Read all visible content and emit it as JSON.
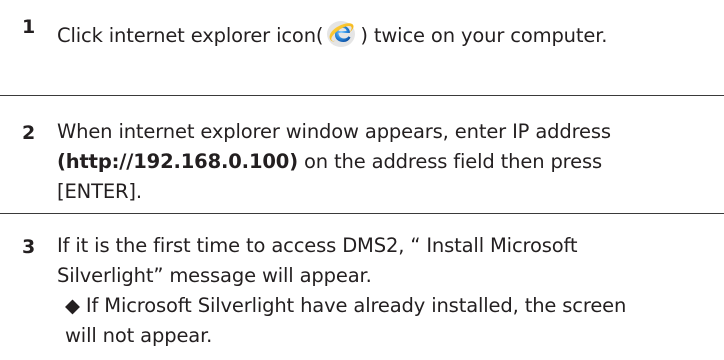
{
  "steps": [
    {
      "number": "1",
      "text_before_icon": "Click internet explorer icon(",
      "icon": "internet-explorer-icon",
      "text_after_icon": ") twice on your computer."
    },
    {
      "number": "2",
      "line1": "When internet explorer window appears, enter IP address",
      "address_bold": "(http://192.168.0.100)",
      "line2_rest": " on the address field then press",
      "line3": "[ENTER]."
    },
    {
      "number": "3",
      "line1": "If it is the first time to access DMS2, “ Install Microsoft",
      "line2": "Silverlight” message will appear.",
      "bullet_symbol": "◆",
      "bullet_line1": " If Microsoft Silverlight have already installed, the screen",
      "bullet_line2": "will not appear."
    }
  ],
  "colors": {
    "text": "#231f20",
    "divider": "#3a3a3a",
    "ie_blue": "#1e78c8"
  }
}
